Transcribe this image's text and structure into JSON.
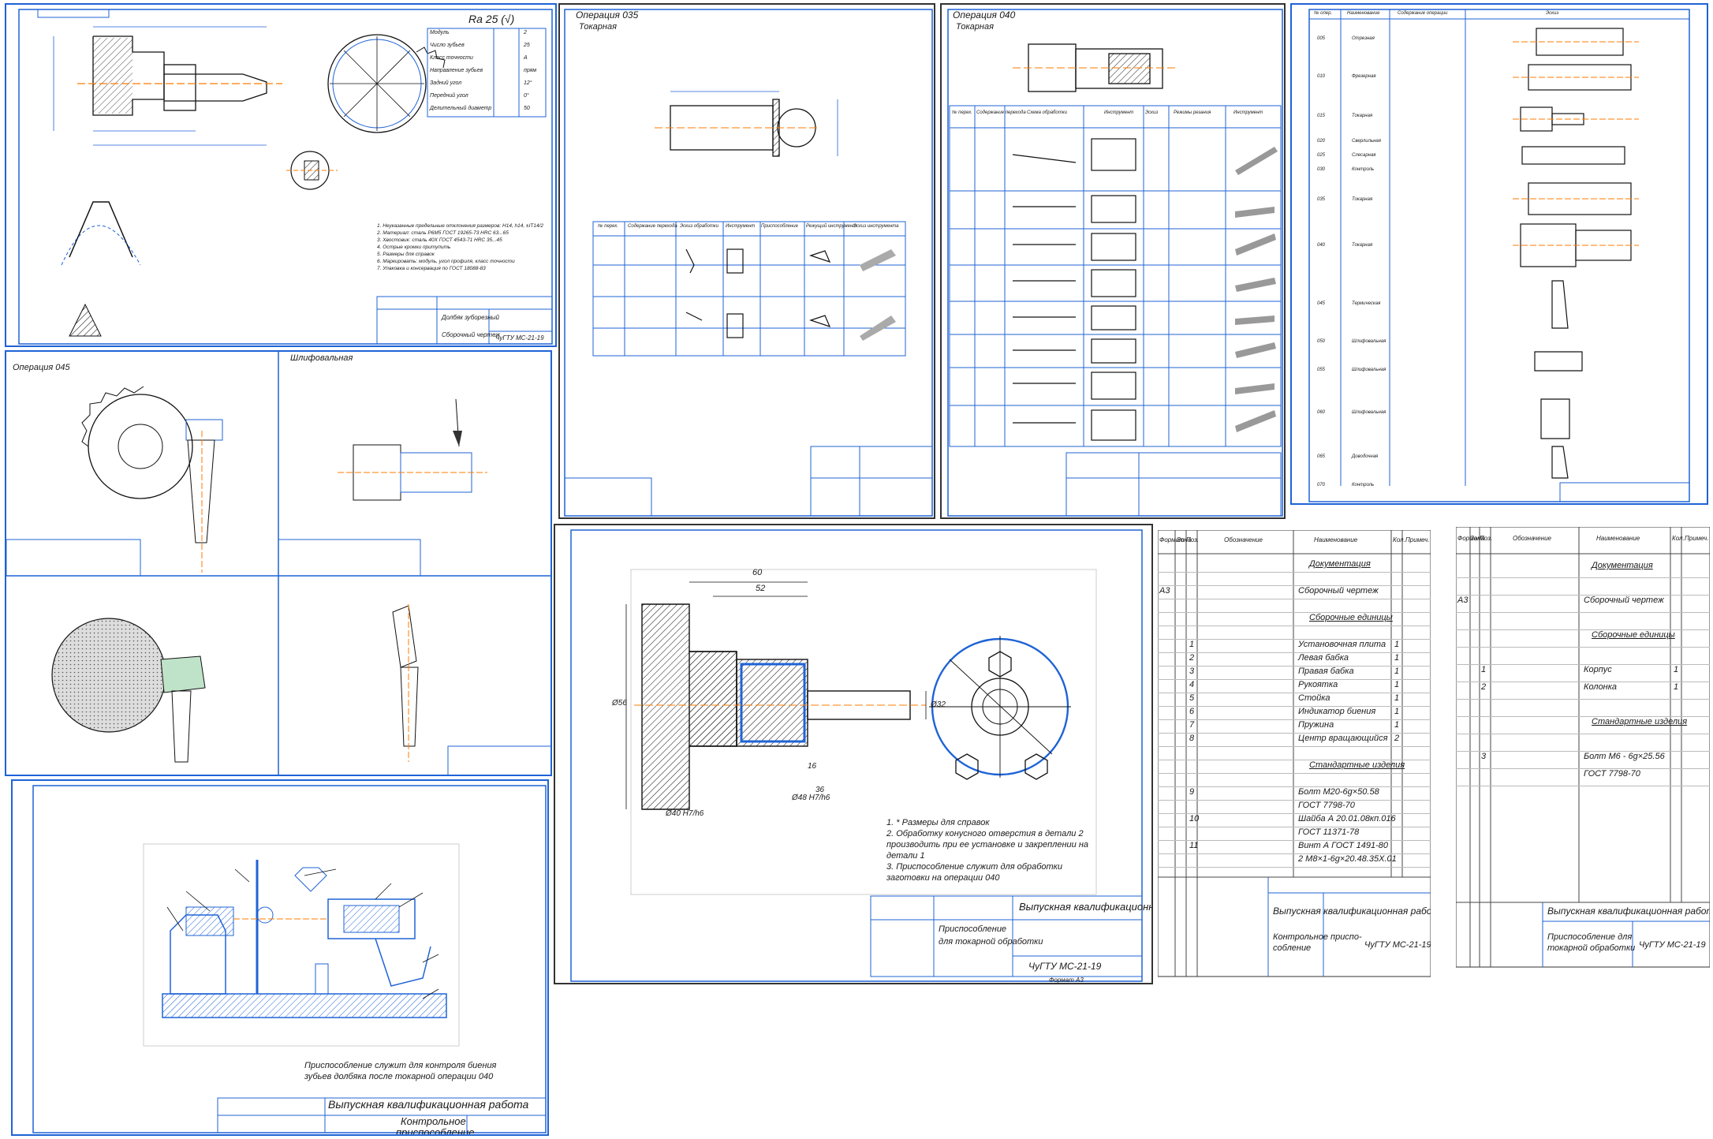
{
  "sheets": {
    "part_drawing": {
      "roughness": "Ra 25 (√)",
      "params": [
        {
          "name": "Модуль",
          "sym": "m",
          "val": "2"
        },
        {
          "name": "Число зубьев",
          "sym": "z",
          "val": "25"
        },
        {
          "name": "Класс точности",
          "sym": "",
          "val": "A"
        },
        {
          "name": "Направление зубьев",
          "sym": "",
          "val": "прям"
        },
        {
          "name": "Задний угол",
          "sym": "α",
          "val": "12°"
        },
        {
          "name": "Передний угол",
          "sym": "γ",
          "val": "0°"
        },
        {
          "name": "Делительный диаметр",
          "sym": "d",
          "val": "50"
        }
      ],
      "notes": [
        "1. Неуказанные предельные отклонения размеров: H14, h14, ±IT14/2",
        "2. Материал: сталь Р6М5 ГОСТ 19265-73 HRC 63...65",
        "3. Хвостовик: сталь 40Х ГОСТ 4543-71 HRC 35...45",
        "4. Острые кромки притупить",
        "5. Размеры для справок",
        "6. Маркировать: модуль, угол профиля, класс точности",
        "7. Упаковка и консервация по ГОСТ 18088-83"
      ],
      "title": "Долбяк зуборезный",
      "subtitle": "Сборочный чертеж",
      "code": "ЧуГТУ МС-21-19"
    },
    "op035": {
      "title": "Операция 035",
      "subtitle": "Токарная",
      "cols": [
        "№ перех.",
        "Содержание перехода",
        "Эскиз обработки",
        "Инструмент",
        "Приспособление",
        "Режущий инструмент",
        "Эскиз инструмента"
      ]
    },
    "op040": {
      "title": "Операция 040",
      "subtitle": "Токарная",
      "cols": [
        "№ перех.",
        "Содержание перехода",
        "Схема обработки",
        "Инструмент",
        "Эскиз",
        "Режимы резания",
        "Инструмент"
      ]
    },
    "route": {
      "cols": [
        "№ опер.",
        "Наименование",
        "Содержание операции",
        "Эскиз"
      ],
      "ops": [
        "005",
        "010",
        "015",
        "020",
        "025",
        "030",
        "035",
        "040",
        "045",
        "050",
        "055",
        "060",
        "065",
        "070"
      ],
      "names": [
        "Отрезная",
        "Фрезерная",
        "Токарная",
        "Сверлильная",
        "Слесарная",
        "Контроль",
        "Токарная",
        "Токарная",
        "Термическая",
        "Шлифовальная",
        "Шлифовальная",
        "Шлифовальная",
        "Доводочная",
        "Контроль"
      ]
    },
    "grinding": {
      "title": "Операция 045",
      "subtitle": "Шлифовальная"
    },
    "fixture": {
      "title": "Приспособление для токарной обработки",
      "dims": [
        "60",
        "52",
        "Ø48 H7/h6",
        "Ø40 H7/h6",
        "Ø32",
        "Ø56",
        "16",
        "36"
      ],
      "notes": [
        "1. * Размеры для справок",
        "2. Обработку конусного отверстия в детали 2",
        "производить при ее установке и закреплении на",
        "детали 1",
        "3. Приспособление служит для обработки",
        "заготовки на операции 040"
      ],
      "stamp": [
        "Выпускная квалификационная работа",
        "Приспособление",
        "для токарной обработки",
        "ЧуГТУ МС-21-19"
      ],
      "format": "Формат А3"
    },
    "control": {
      "note": "Приспособление служит для контроля биения",
      "note2": "зубьев долбяка после токарной операции 040",
      "stamp": [
        "Выпускная квалификационная работа",
        "Контрольное",
        "приспособление",
        "ЧуГТУ МС-21-19"
      ]
    },
    "spec1": {
      "headers": [
        "Формат",
        "Зона",
        "Поз.",
        "Обозначение",
        "Наименование",
        "Кол.",
        "Примеч."
      ],
      "rows": [
        {
          "pos": "",
          "name": "Документация",
          "qty": ""
        },
        {
          "pos": "",
          "name": "",
          "qty": ""
        },
        {
          "pos": "",
          "name": "Сборочный чертеж",
          "qty": "",
          "fmt": "А3"
        },
        {
          "pos": "",
          "name": "",
          "qty": ""
        },
        {
          "pos": "",
          "name": "Сборочные единицы",
          "qty": ""
        },
        {
          "pos": "",
          "name": "",
          "qty": ""
        },
        {
          "pos": "1",
          "name": "Установочная плита",
          "qty": "1"
        },
        {
          "pos": "2",
          "name": "Левая бабка",
          "qty": "1"
        },
        {
          "pos": "3",
          "name": "Правая бабка",
          "qty": "1"
        },
        {
          "pos": "4",
          "name": "Рукоятка",
          "qty": "1"
        },
        {
          "pos": "5",
          "name": "Стойка",
          "qty": "1"
        },
        {
          "pos": "6",
          "name": "Индикатор биения",
          "qty": "1"
        },
        {
          "pos": "7",
          "name": "Пружина",
          "qty": "1"
        },
        {
          "pos": "8",
          "name": "Центр вращающийся",
          "qty": "2"
        },
        {
          "pos": "",
          "name": "",
          "qty": ""
        },
        {
          "pos": "",
          "name": "Стандартные изделия",
          "qty": ""
        },
        {
          "pos": "",
          "name": "",
          "qty": ""
        },
        {
          "pos": "9",
          "name": "Болт М20-6g×50.58",
          "qty": ""
        },
        {
          "pos": "",
          "name": "ГОСТ 7798-70",
          "qty": ""
        },
        {
          "pos": "10",
          "name": "Шайба А 20.01.08кп.016",
          "qty": ""
        },
        {
          "pos": "",
          "name": "ГОСТ 11371-78",
          "qty": ""
        },
        {
          "pos": "11",
          "name": "Винт А ГОСТ 1491-80",
          "qty": ""
        },
        {
          "pos": "",
          "name": "2 М8×1-6g×20.48.35Х.01",
          "qty": ""
        }
      ],
      "stamp": [
        "Выпускная квалификационная работа",
        "Контрольное приспо-",
        "собление",
        "ЧуГТУ МС-21-19"
      ]
    },
    "spec2": {
      "headers": [
        "Формат",
        "Зона",
        "Поз.",
        "Обозначение",
        "Наименование",
        "Кол.",
        "Примеч."
      ],
      "rows": [
        {
          "pos": "",
          "name": "Документация",
          "qty": ""
        },
        {
          "pos": "",
          "name": "",
          "qty": ""
        },
        {
          "pos": "",
          "name": "Сборочный чертеж",
          "qty": "",
          "fmt": "А3"
        },
        {
          "pos": "",
          "name": "",
          "qty": ""
        },
        {
          "pos": "",
          "name": "Сборочные единицы",
          "qty": ""
        },
        {
          "pos": "",
          "name": "",
          "qty": ""
        },
        {
          "pos": "1",
          "name": "Корпус",
          "qty": "1"
        },
        {
          "pos": "2",
          "name": "Колонка",
          "qty": "1"
        },
        {
          "pos": "",
          "name": "",
          "qty": ""
        },
        {
          "pos": "",
          "name": "Стандартные изделия",
          "qty": ""
        },
        {
          "pos": "",
          "name": "",
          "qty": ""
        },
        {
          "pos": "3",
          "name": "Болт М6 - 6g×25.56",
          "qty": ""
        },
        {
          "pos": "",
          "name": "ГОСТ 7798-70",
          "qty": ""
        }
      ],
      "stamp": [
        "Выпускная квалификационная работа",
        "Приспособление для",
        "токарной обработки",
        "ЧуГТУ МС-21-19"
      ]
    }
  }
}
